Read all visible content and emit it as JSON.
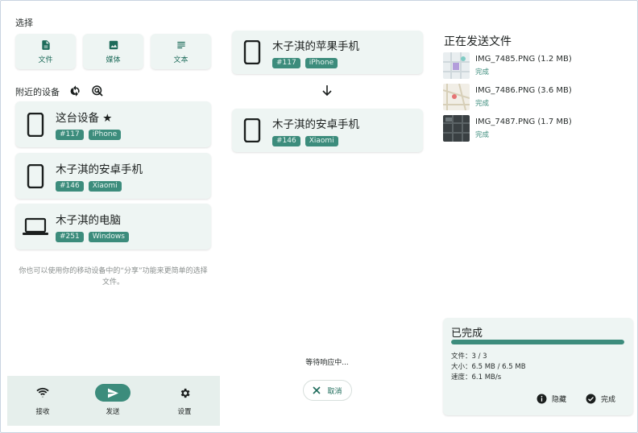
{
  "left": {
    "select_label": "选择",
    "select_buttons": [
      {
        "label": "文件",
        "icon": "file-icon"
      },
      {
        "label": "媒体",
        "icon": "image-icon"
      },
      {
        "label": "文本",
        "icon": "text-icon"
      }
    ],
    "nearby_label": "附近的设备",
    "devices": [
      {
        "name": "这台设备 ★",
        "id": "#117",
        "model": "iPhone",
        "icon": "phone-icon"
      },
      {
        "name": "木子淇的安卓手机",
        "id": "#146",
        "model": "Xiaomi",
        "icon": "phone-icon"
      },
      {
        "name": "木子淇的电脑",
        "id": "#251",
        "model": "Windows",
        "icon": "laptop-icon"
      }
    ],
    "hint": "你也可以使用你的移动设备中的“分享”功能来更简单的选择文件。"
  },
  "nav": {
    "items": [
      {
        "label": "接收",
        "icon": "wifi-icon",
        "active": false
      },
      {
        "label": "发送",
        "icon": "send-icon",
        "active": true
      },
      {
        "label": "设置",
        "icon": "gear-icon",
        "active": false
      }
    ]
  },
  "middle": {
    "sender": {
      "name": "木子淇的苹果手机",
      "id": "#117",
      "model": "iPhone"
    },
    "receiver": {
      "name": "木子淇的安卓手机",
      "id": "#146",
      "model": "Xiaomi"
    },
    "waiting_text": "等待响应中...",
    "cancel_label": "取消"
  },
  "right": {
    "title": "正在发送文件",
    "files": [
      {
        "name": "IMG_7485.PNG (1.2 MB)",
        "status": "完成"
      },
      {
        "name": "IMG_7486.PNG (3.6 MB)",
        "status": "完成"
      },
      {
        "name": "IMG_7487.PNG (1.7 MB)",
        "status": "完成"
      }
    ],
    "summary": {
      "title": "已完成",
      "progress": 1.0,
      "files_line": "文件：3 / 3",
      "size_line": "大小：6.5 MB / 6.5 MB",
      "speed_line": "速度：6.1 MB/s",
      "hide_label": "隐藏",
      "done_label": "完成"
    }
  },
  "colors": {
    "accent": "#3c8c7c",
    "card": "#eef5f3",
    "nav_bg": "#e6efec"
  }
}
